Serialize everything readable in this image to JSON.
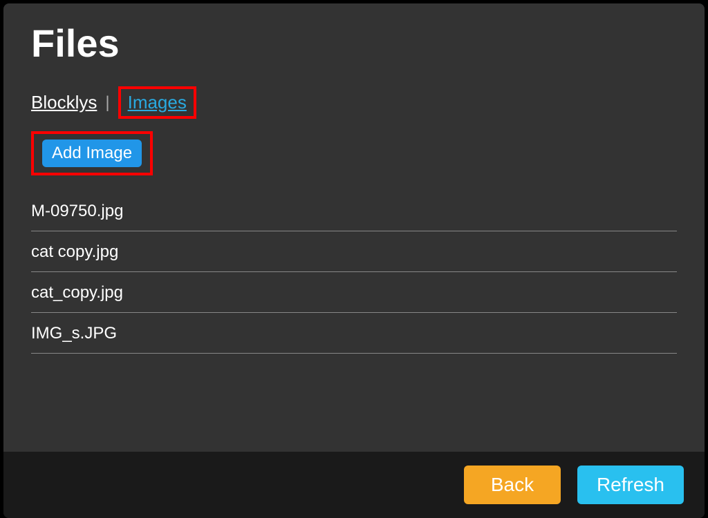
{
  "title": "Files",
  "tabs": {
    "blocklys": "Blocklys",
    "separator": "|",
    "images": "Images"
  },
  "addButton": "Add Image",
  "files": [
    "M-09750.jpg",
    "cat copy.jpg",
    "cat_copy.jpg",
    "IMG_s.JPG"
  ],
  "footer": {
    "back": "Back",
    "refresh": "Refresh"
  }
}
